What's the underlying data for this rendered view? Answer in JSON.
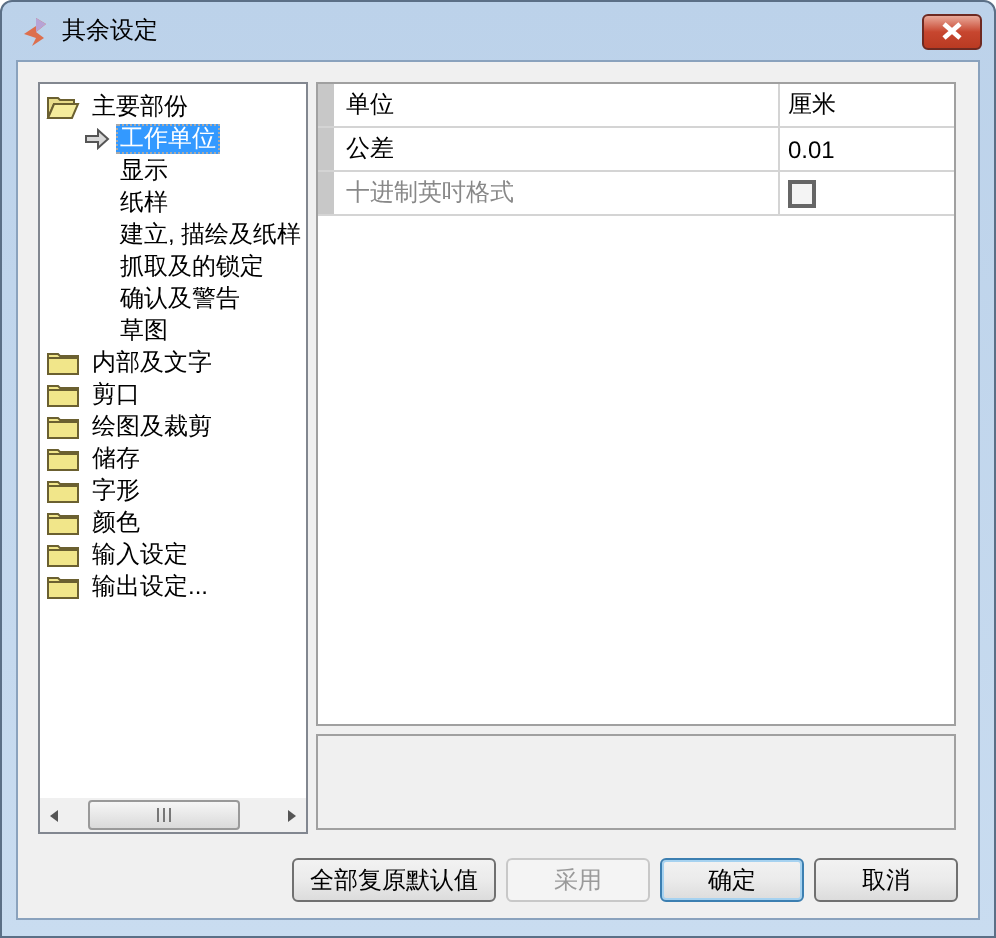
{
  "window": {
    "title": "其余设定"
  },
  "tree": {
    "items": [
      {
        "label": "主要部份",
        "expanded": true,
        "children": [
          {
            "label": "工作单位",
            "selected": true
          },
          {
            "label": "显示",
            "selected": false
          },
          {
            "label": "纸样",
            "selected": false
          },
          {
            "label": "建立, 描绘及纸样",
            "selected": false
          },
          {
            "label": "抓取及的锁定",
            "selected": false
          },
          {
            "label": "确认及警告",
            "selected": false
          },
          {
            "label": "草图",
            "selected": false
          }
        ]
      },
      {
        "label": "内部及文字",
        "expanded": false
      },
      {
        "label": "剪口",
        "expanded": false
      },
      {
        "label": "绘图及裁剪",
        "expanded": false
      },
      {
        "label": "储存",
        "expanded": false
      },
      {
        "label": "字形",
        "expanded": false
      },
      {
        "label": "颜色",
        "expanded": false
      },
      {
        "label": "输入设定",
        "expanded": false
      },
      {
        "label": "输出设定...",
        "expanded": false
      }
    ]
  },
  "properties": [
    {
      "name": "单位",
      "kind": "text",
      "value": "厘米",
      "disabled": false
    },
    {
      "name": "公差",
      "kind": "text",
      "value": "0.01",
      "disabled": false
    },
    {
      "name": "十进制英吋格式",
      "kind": "checkbox",
      "checked": false,
      "disabled": true
    }
  ],
  "buttons": [
    {
      "label": "全部复原默认值",
      "disabled": false,
      "default": false
    },
    {
      "label": "采用",
      "disabled": true,
      "default": false
    },
    {
      "label": "确定",
      "disabled": false,
      "default": true
    },
    {
      "label": "取消",
      "disabled": false,
      "default": false
    }
  ]
}
